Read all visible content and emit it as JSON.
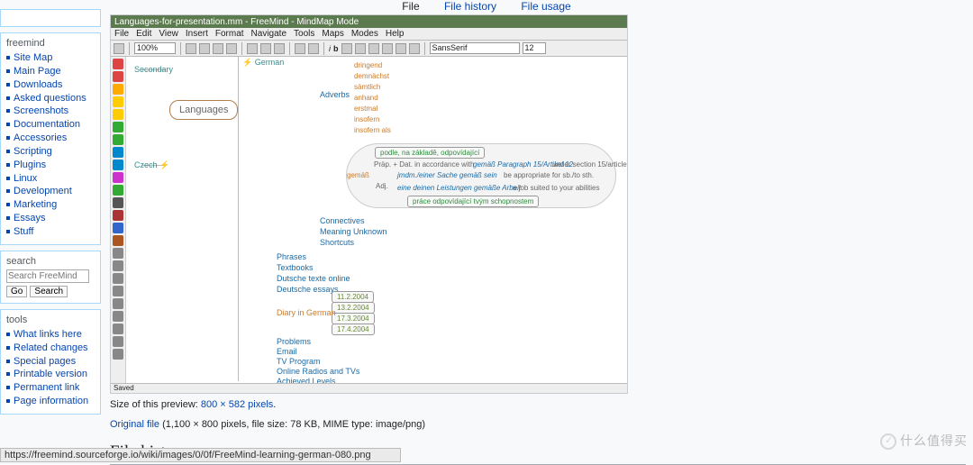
{
  "file_tabs": {
    "file": "File",
    "history": "File history",
    "usage": "File usage"
  },
  "sidebar": {
    "nav_title": "freemind",
    "nav": [
      "Site Map",
      "Main Page",
      "Downloads",
      "Asked questions",
      "Screenshots",
      "Documentation",
      "Accessories",
      "Scripting",
      "Plugins",
      "Linux",
      "Development",
      "Marketing",
      "Essays",
      "Stuff"
    ],
    "search_title": "search",
    "search": {
      "placeholder": "Search FreeMind",
      "go": "Go",
      "search": "Search"
    },
    "tools_title": "tools",
    "tools": [
      "What links here",
      "Related changes",
      "Special pages",
      "Printable version",
      "Permanent link",
      "Page information"
    ]
  },
  "freemind": {
    "title": "Languages-for-presentation.mm - FreeMind - MindMap Mode",
    "menu": [
      "File",
      "Edit",
      "View",
      "Insert",
      "Format",
      "Navigate",
      "Tools",
      "Maps",
      "Modes",
      "Help"
    ],
    "zoom": "100%",
    "font": "SansSerif",
    "fontsize": "12",
    "status": "Saved",
    "root": "Languages",
    "secondary": "Secondary",
    "czech": "Czech",
    "german": "German",
    "adverbs": "Adverbs",
    "adv": [
      "dringend",
      "demnächst",
      "sämtlich",
      "anhand",
      "erstmal",
      "insofern",
      "insofern als"
    ],
    "gemass": "gemäß",
    "adj": "Adj.",
    "cloud_top": "podle, na základě, odpovídající",
    "c1": "Präp. + Dat. in accordance with",
    "c1b": "gemäß Paragraph 15/Artikel 12",
    "c1c": "under section 15/article",
    "c2": "jmdm./einer Sache gemäß sein",
    "c2b": "be appropriate for sb./to sth.",
    "c3": "eine deinen Leistungen gemäße Arbeit",
    "c3b": "a job suited to your abilities",
    "c4": "práce odpovídající tvým schopnostem",
    "mid": [
      "Connectives",
      "Meaning Unknown",
      "Shortcuts"
    ],
    "lower": [
      "Phrases",
      "Textbooks",
      "Dutsche texte online",
      "Deutsche essays"
    ],
    "dates": [
      "11.2.2004",
      "13.2.2004",
      "17.3.2004",
      "17.4.2004"
    ],
    "diary": "Diary in German",
    "bottom": [
      "Problems",
      "Email",
      "TV Program",
      "Online Radios and TVs",
      "Achieved Levels"
    ]
  },
  "caption": {
    "prefix": "Size of this preview: ",
    "size": "800 × 582 pixels",
    "orig": "Original file",
    "orig_rest": " (1,100 × 800 pixels, file size: 78 KB, MIME type: image/png)"
  },
  "section": "File history",
  "statusbar": "https://freemind.sourceforge.io/wiki/images/0/0f/FreeMind-learning-german-080.png",
  "watermark": "什么值得买"
}
